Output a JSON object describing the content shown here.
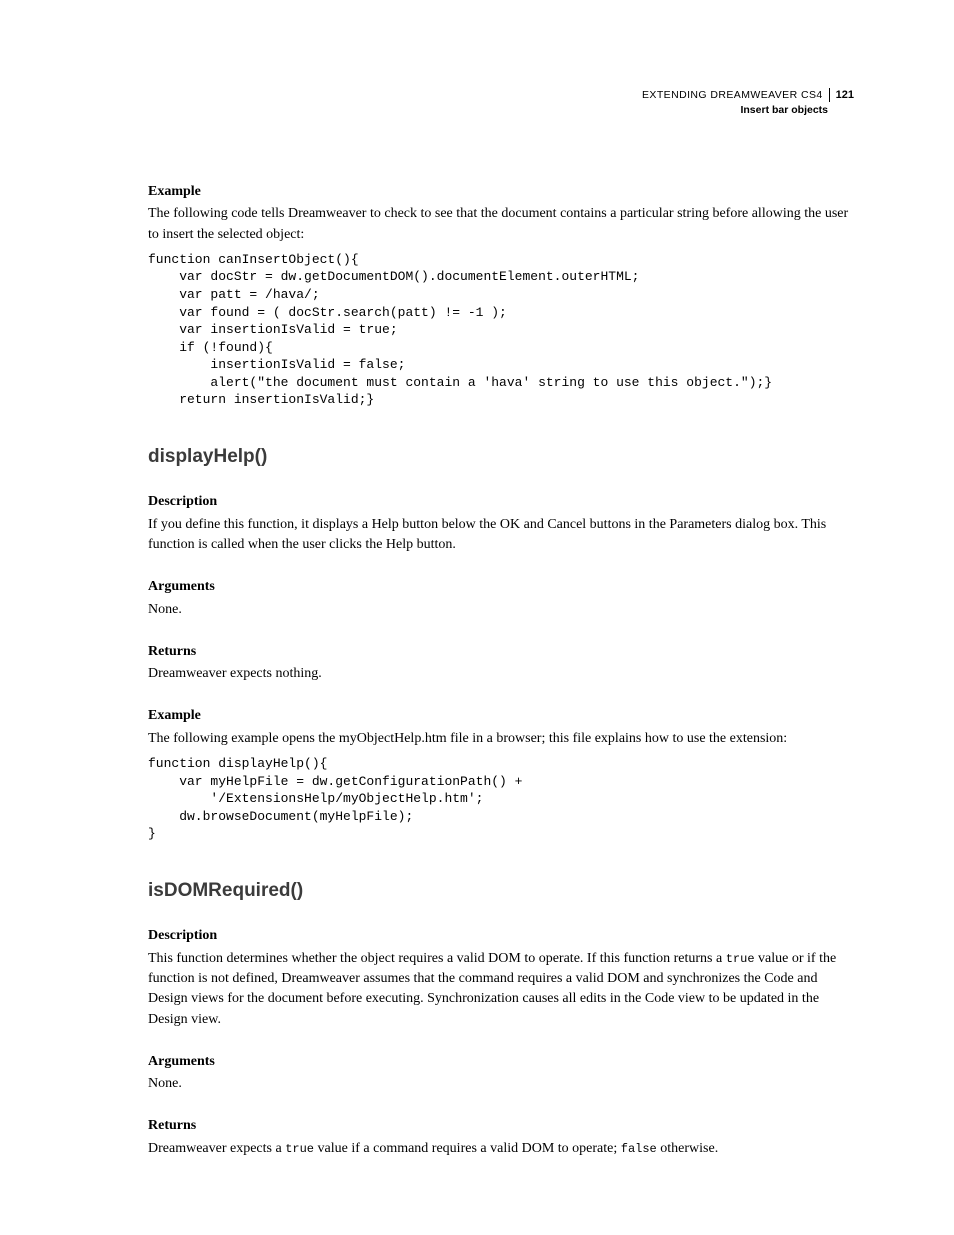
{
  "header": {
    "title": "EXTENDING DREAMWEAVER CS4",
    "subtitle": "Insert bar objects",
    "page_number": "121"
  },
  "sections": {
    "example1": {
      "heading": "Example",
      "body": "The following code tells Dreamweaver to check to see that the document contains a particular string before allowing the user to insert the selected object:",
      "code": "function canInsertObject(){ \n    var docStr = dw.getDocumentDOM().documentElement.outerHTML; \n    var patt = /hava/; \n    var found = ( docStr.search(patt) != -1 ); \n    var insertionIsValid = true;  \n    if (!found){ \n        insertionIsValid = false; \n        alert(\"the document must contain a 'hava' string to use this object.\");} \n    return insertionIsValid;}"
    },
    "displayHelp": {
      "title": "displayHelp()",
      "desc_heading": "Description",
      "desc_body": "If you define this function, it displays a Help button below the OK and Cancel buttons in the Parameters dialog box. This function is called when the user clicks the Help button.",
      "args_heading": "Arguments",
      "args_body": "None.",
      "returns_heading": "Returns",
      "returns_body": "Dreamweaver expects nothing.",
      "example_heading": "Example",
      "example_body": "The following example opens the myObjectHelp.htm file in a browser; this file explains how to use the extension:",
      "example_code": "function displayHelp(){ \n    var myHelpFile = dw.getConfigurationPath() + \n        '/ExtensionsHelp/myObjectHelp.htm'; \n    dw.browseDocument(myHelpFile);  \n}"
    },
    "isDOMRequired": {
      "title": "isDOMRequired()",
      "desc_heading": "Description",
      "desc_body_pre": "This function determines whether the object requires a valid DOM to operate. If this function returns a ",
      "desc_true": "true",
      "desc_body_post": " value or if the function is not defined, Dreamweaver assumes that the command requires a valid DOM and synchronizes the Code and Design views for the document before executing. Synchronization causes all edits in the Code view to be updated in the Design view.",
      "args_heading": "Arguments",
      "args_body": "None.",
      "returns_heading": "Returns",
      "returns_body_pre": "Dreamweaver expects a ",
      "returns_true": "true",
      "returns_body_mid": " value if a command requires a valid DOM to operate; ",
      "returns_false": "false",
      "returns_body_post": " otherwise."
    }
  }
}
